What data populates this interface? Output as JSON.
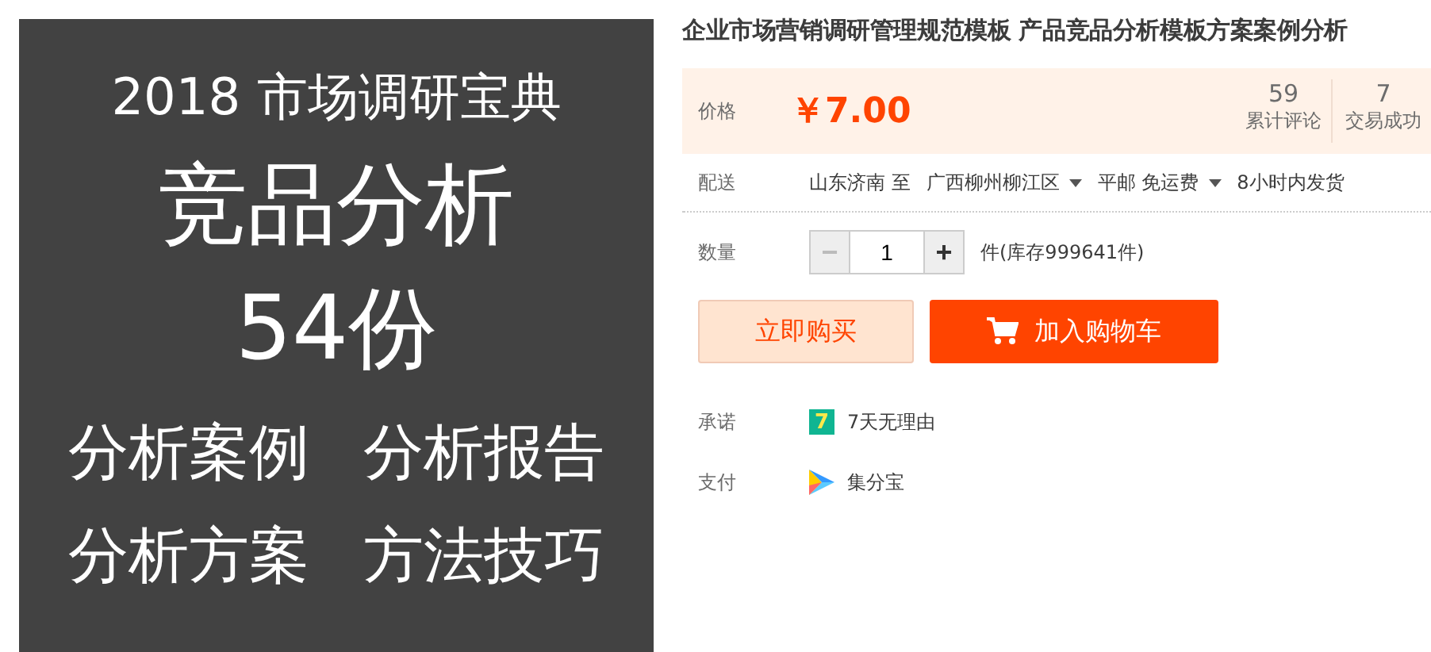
{
  "product_image": {
    "lines": [
      "2018 市场调研宝典",
      "竞品分析",
      "54份"
    ],
    "tags": [
      "分析案例",
      "分析报告",
      "分析方案",
      "方法技巧"
    ]
  },
  "title": "企业市场营销调研管理规范模板 产品竞品分析模板方案案例分析",
  "price": {
    "label": "价格",
    "value": "￥7.00",
    "stats": [
      {
        "count": "59",
        "label": "累计评论"
      },
      {
        "count": "7",
        "label": "交易成功"
      }
    ]
  },
  "delivery": {
    "label": "配送",
    "from": "山东济南 至",
    "to": "广西柳州柳江区",
    "shipping": "平邮 免运费",
    "time": "8小时内发货"
  },
  "quantity": {
    "label": "数量",
    "minus": "−",
    "value": "1",
    "plus": "+",
    "stock": "件(库存999641件)"
  },
  "buttons": [
    {
      "kind": "buy",
      "label": "立即购买"
    },
    {
      "kind": "cart",
      "label": "加入购物车"
    }
  ],
  "services": [
    {
      "kind": "seven",
      "label": "承诺",
      "badge": "7",
      "text": "7天无理由"
    },
    {
      "kind": "pay",
      "label": "支付",
      "text": "集分宝"
    }
  ]
}
